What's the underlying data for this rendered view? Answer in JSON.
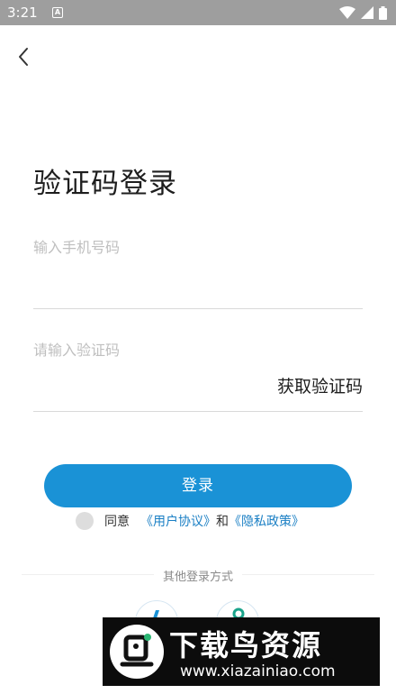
{
  "status_bar": {
    "time": "3:21",
    "app_icon_letter": "A"
  },
  "page": {
    "title": "验证码登录",
    "phone_placeholder": "输入手机号码",
    "code_placeholder": "请输入验证码",
    "get_code_label": "获取验证码",
    "login_label": "登录"
  },
  "agreement": {
    "agree_label": "同意",
    "user_agreement_link": "《用户协议》",
    "and_label": "和",
    "privacy_policy_link": "《隐私政策》"
  },
  "other_login": {
    "label": "其他登录方式"
  },
  "watermark": {
    "title": "下载鸟资源",
    "url": "www.xiazainiao.com"
  },
  "colors": {
    "accent": "#1a92d6",
    "link": "#1a7fc4",
    "status_bar": "#9e9e9e"
  }
}
